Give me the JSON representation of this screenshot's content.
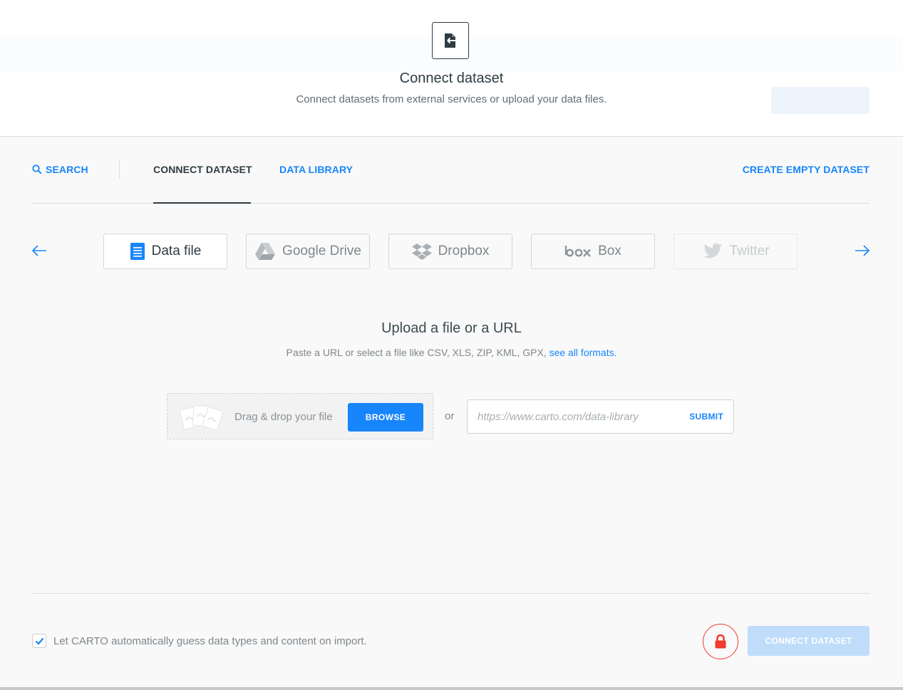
{
  "header": {
    "title": "Connect dataset",
    "subtitle": "Connect datasets from external services or upload your data files."
  },
  "tabs": {
    "search": "SEARCH",
    "connect": "CONNECT DATASET",
    "library": "DATA LIBRARY",
    "create": "CREATE EMPTY DATASET"
  },
  "services": [
    {
      "label": "Data file",
      "icon": "data-file-icon",
      "state": "active"
    },
    {
      "label": "Google Drive",
      "icon": "google-drive-icon",
      "state": "normal"
    },
    {
      "label": "Dropbox",
      "icon": "dropbox-icon",
      "state": "normal"
    },
    {
      "label": "Box",
      "icon": "box-icon",
      "state": "normal"
    },
    {
      "label": "Twitter",
      "icon": "twitter-icon",
      "state": "disabled"
    }
  ],
  "upload": {
    "title": "Upload a file or a URL",
    "desc": "Paste a URL or select a file like CSV, XLS, ZIP, KML, GPX,",
    "formats_link": "see all formats",
    "desc_end": ".",
    "drop_text": "Drag & drop your file",
    "browse": "BROWSE",
    "or": "or",
    "url_placeholder": "https://www.carto.com/data-library",
    "submit": "SUBMIT"
  },
  "footer": {
    "guess_label": "Let CARTO automatically guess data types and content on import.",
    "guess_checked": true,
    "connect": "CONNECT DATASET"
  },
  "colors": {
    "accent": "#1785fb",
    "lock": "#f03b2f",
    "disabled_button": "#bfdcfb"
  }
}
